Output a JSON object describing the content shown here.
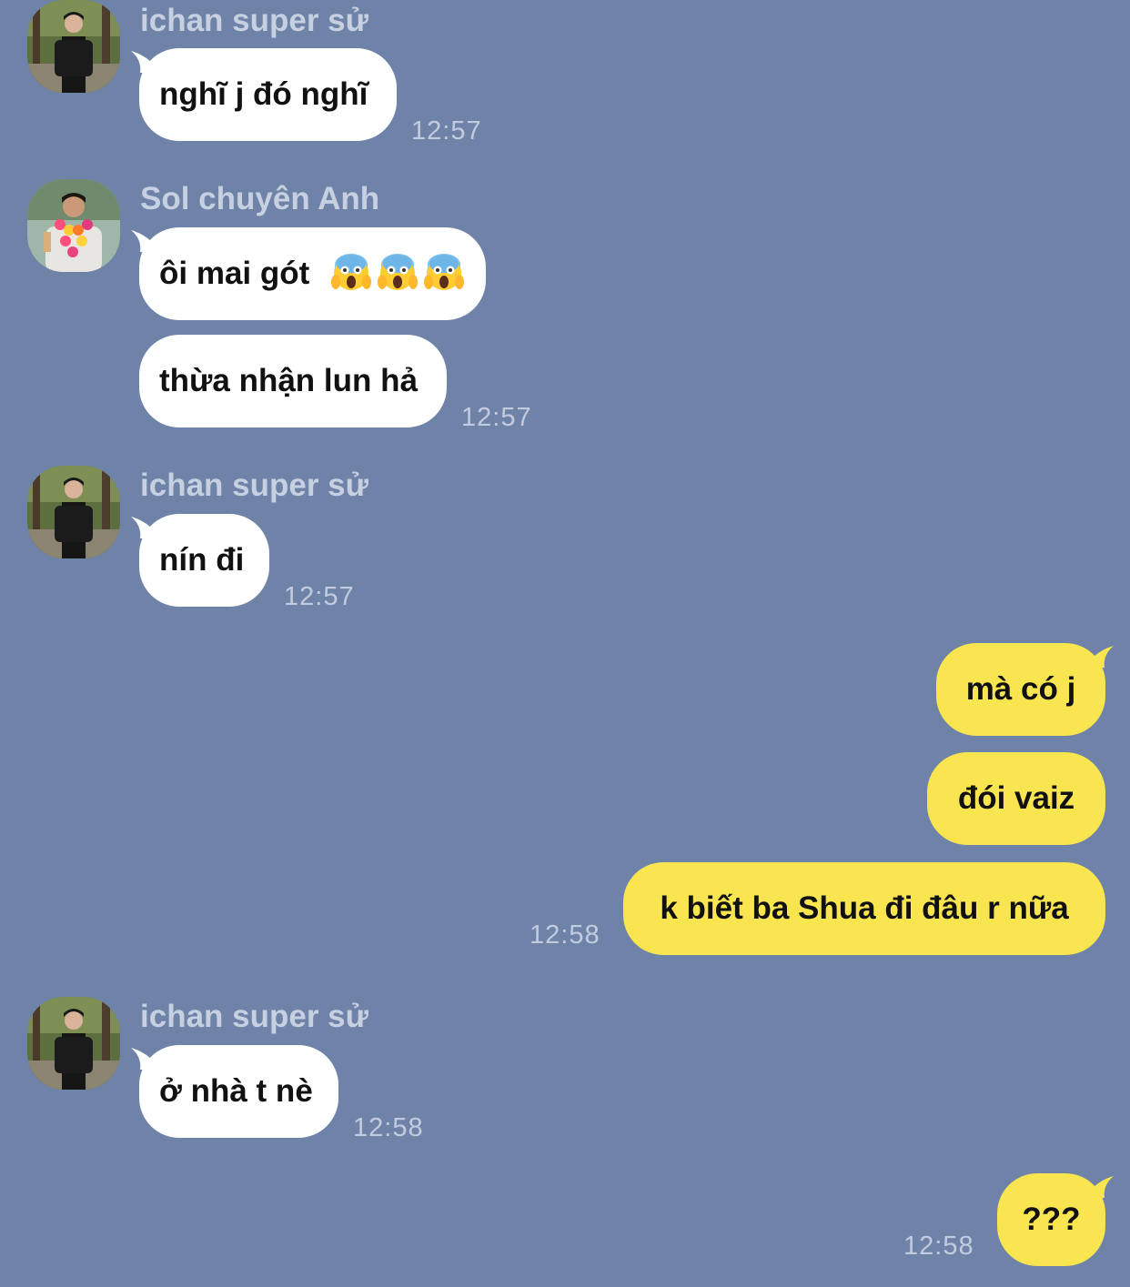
{
  "messages": [
    {
      "sender": "ichan super sử",
      "avatar": "avatar-ichan",
      "bubbles": [
        "nghĩ j đó nghĩ"
      ],
      "time": "12:57"
    },
    {
      "sender": "Sol chuyên Anh",
      "avatar": "avatar-sol",
      "bubbles": [
        "ôi mai gót",
        "thừa nhận lun hả"
      ],
      "emoji": "face-screaming-in-fear",
      "time": "12:57"
    },
    {
      "sender": "ichan super sử",
      "avatar": "avatar-ichan",
      "bubbles": [
        "nín đi"
      ],
      "time": "12:57"
    },
    {
      "sender": "me",
      "bubbles": [
        "mà có j",
        "đói vaiz",
        "k biết ba Shua đi đâu r nữa"
      ],
      "time": "12:58"
    },
    {
      "sender": "ichan super sử",
      "avatar": "avatar-ichan",
      "bubbles": [
        "ở nhà t nè"
      ],
      "time": "12:58"
    },
    {
      "sender": "me",
      "bubbles": [
        "???"
      ],
      "time": "12:58"
    }
  ],
  "colors": {
    "background": "#6f83a8",
    "incoming_bubble": "#ffffff",
    "outgoing_bubble": "#f9e54f",
    "sender_name": "#c6d0e1",
    "timestamp": "#c3ccde"
  }
}
